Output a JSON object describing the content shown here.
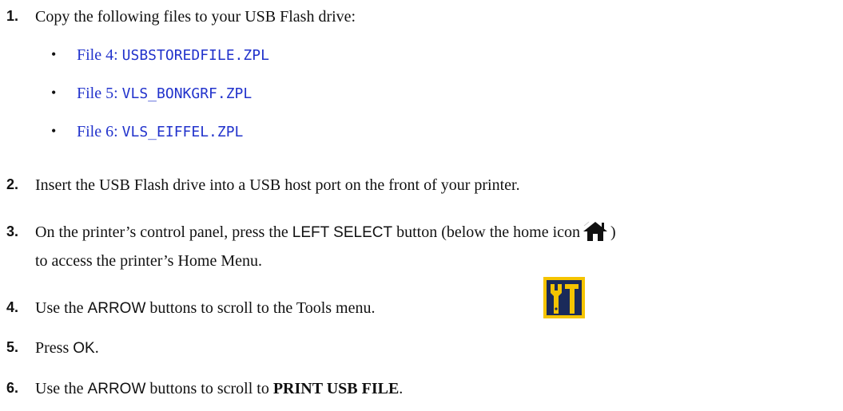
{
  "steps": [
    {
      "num": "1.",
      "text": "Copy the following files to your USB Flash drive:"
    },
    {
      "num": "2.",
      "text": "Insert the USB Flash drive into a USB host port on the front of your printer."
    },
    {
      "num": "3.",
      "text_before": "On the printer’s control panel, press the ",
      "button": "LEFT SELECT",
      "text_mid": " button (below the home icon",
      "text_after": ")",
      "line2": "to access the printer’s Home Menu."
    },
    {
      "num": "4.",
      "text_before": "Use the ",
      "button": "ARROW",
      "text_after": " buttons to scroll to the Tools menu."
    },
    {
      "num": "5.",
      "text_before": "Press ",
      "button": "OK",
      "text_after": "."
    },
    {
      "num": "6.",
      "text_before": "Use the ",
      "button": "ARROW",
      "text_mid": " buttons to scroll to ",
      "bold": "PRINT USB FILE",
      "text_after": "."
    }
  ],
  "files": [
    {
      "label": "File 4: ",
      "name": "USBSTOREDFILE.ZPL"
    },
    {
      "label": "File 5: ",
      "name": "VLS_BONKGRF.ZPL"
    },
    {
      "label": "File 6: ",
      "name": "VLS_EIFFEL.ZPL"
    }
  ],
  "bullet": "•",
  "colors": {
    "link": "#2233cc",
    "tools_icon_bg": "#f5c400",
    "tools_icon_fg": "#1a2a5a"
  }
}
